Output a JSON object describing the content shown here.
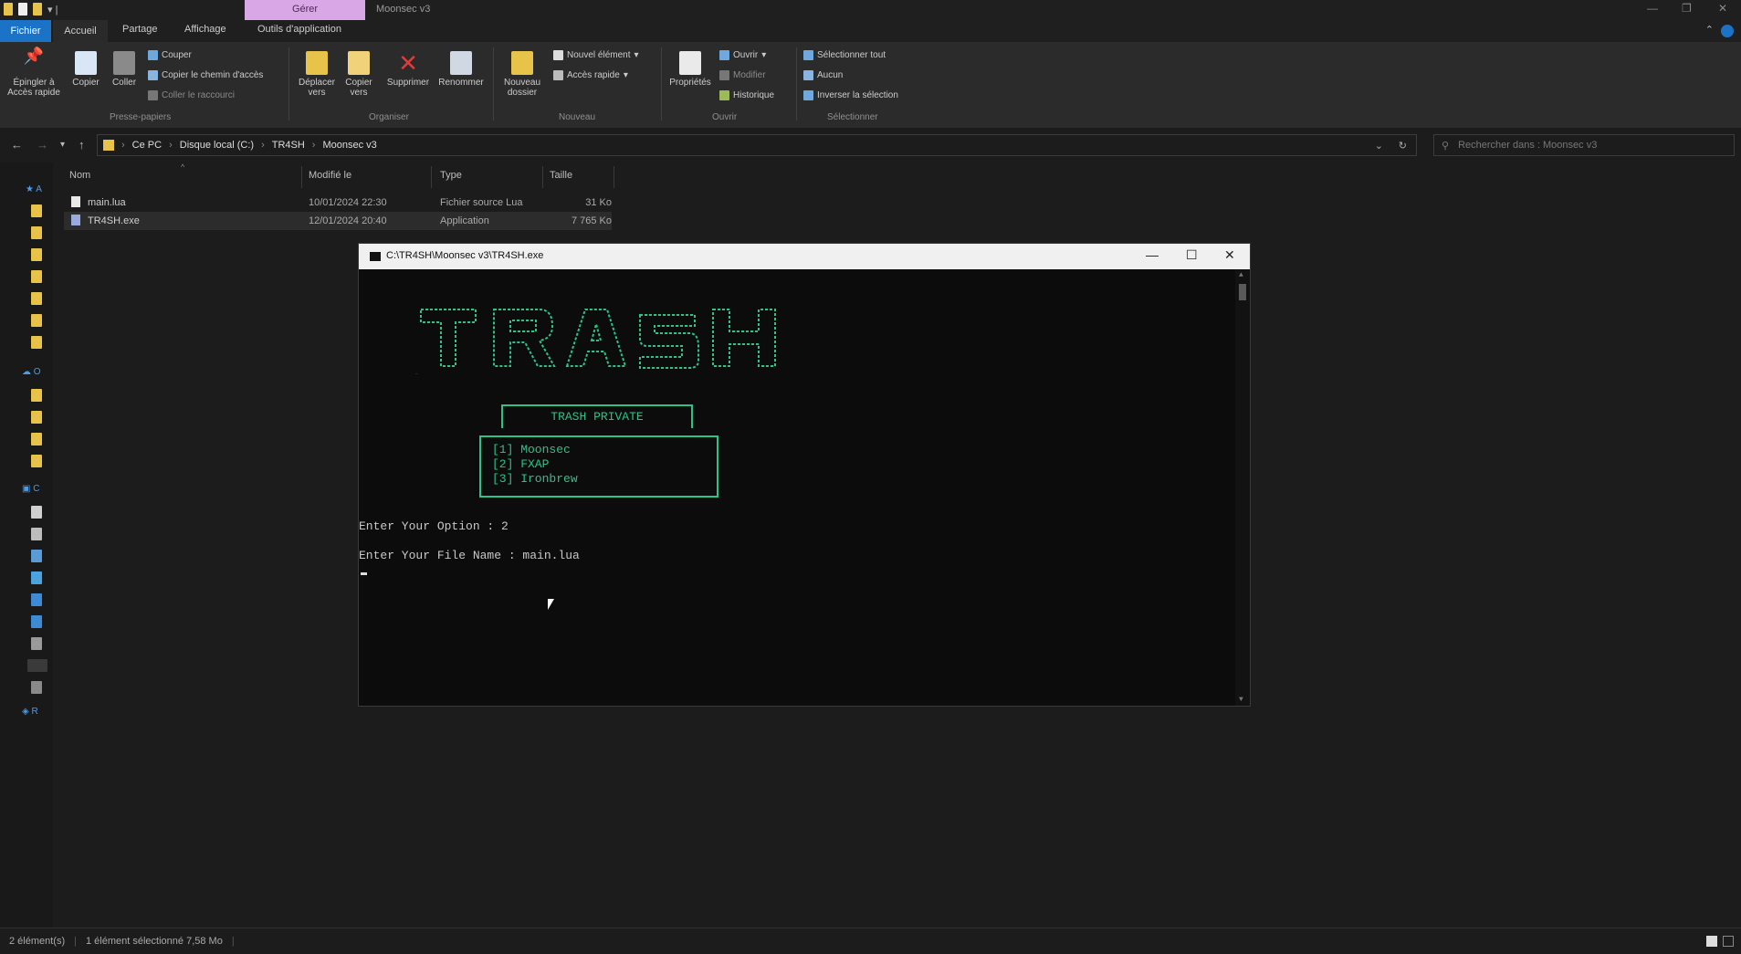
{
  "titlebar": {
    "context_tab": "Gérer",
    "window_title": "Moonsec v3"
  },
  "tabs": [
    "Fichier",
    "Accueil",
    "Partage",
    "Affichage",
    "Outils d'application"
  ],
  "ribbon": {
    "pin": "Épingler à Accès rapide",
    "copy": "Copier",
    "paste": "Coller",
    "cut": "Couper",
    "copy_path": "Copier le chemin d'accès",
    "paste_shortcut": "Coller le raccourci",
    "group_clipboard": "Presse-papiers",
    "move_to": "Déplacer vers",
    "copy_to": "Copier vers",
    "delete": "Supprimer",
    "rename": "Renommer",
    "group_organize": "Organiser",
    "new_folder": "Nouveau dossier",
    "new_item": "Nouvel élément",
    "easy_access": "Accès rapide",
    "group_new": "Nouveau",
    "properties": "Propriétés",
    "open": "Ouvrir",
    "edit": "Modifier",
    "history": "Historique",
    "group_open": "Ouvrir",
    "select_all": "Sélectionner tout",
    "select_none": "Aucun",
    "invert_selection": "Inverser la sélection",
    "group_select": "Sélectionner"
  },
  "address": {
    "crumbs": [
      "Ce PC",
      "Disque local (C:)",
      "TR4SH",
      "Moonsec v3"
    ],
    "search_placeholder": "Rechercher dans : Moonsec v3"
  },
  "columns": {
    "name": "Nom",
    "modified": "Modifié le",
    "type": "Type",
    "size": "Taille"
  },
  "files": [
    {
      "name": "main.lua",
      "modified": "10/01/2024 22:30",
      "type": "Fichier source Lua",
      "size": "31 Ko"
    },
    {
      "name": "TR4SH.exe",
      "modified": "12/01/2024 20:40",
      "type": "Application",
      "size": "7 765 Ko"
    }
  ],
  "status": {
    "count": "2 élément(s)",
    "selection": "1 élément sélectionné 7,58 Mo"
  },
  "console": {
    "title": "C:\\TR4SH\\Moonsec v3\\TR4SH.exe",
    "ascii_art": "TRASH",
    "header": "TRASH PRIVATE",
    "options": [
      "[1] Moonsec",
      "[2] FXAP",
      "[3] Ironbrew"
    ],
    "prompt_option": "Enter Your Option : 2",
    "prompt_file": "Enter Your File Name : main.lua"
  },
  "colors": {
    "console_green": "#2ac38a",
    "accent_blue": "#1a73c7",
    "context_tab": "#d9a7e6"
  }
}
